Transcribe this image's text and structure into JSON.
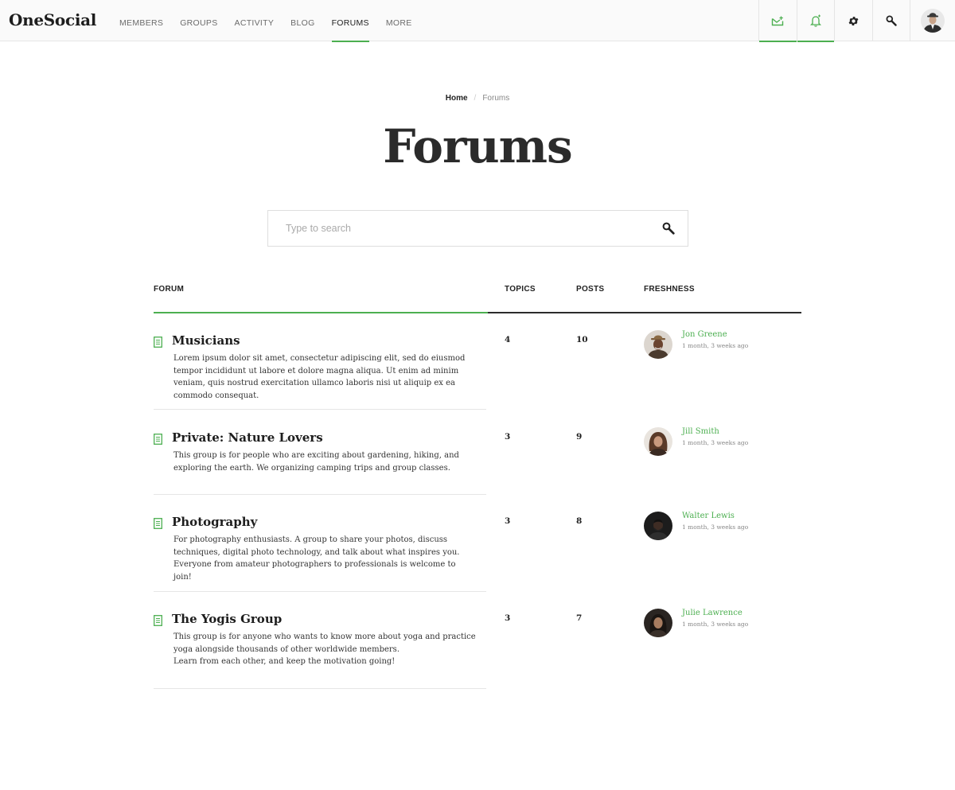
{
  "header": {
    "logo": "OneSocial",
    "nav": [
      {
        "label": "MEMBERS",
        "active": false
      },
      {
        "label": "GROUPS",
        "active": false
      },
      {
        "label": "ACTIVITY",
        "active": false
      },
      {
        "label": "BLOG",
        "active": false
      },
      {
        "label": "FORUMS",
        "active": true
      },
      {
        "label": "MORE",
        "active": false
      }
    ],
    "tools": [
      {
        "icon": "inbox-icon",
        "highlight": true
      },
      {
        "icon": "bell-icon",
        "highlight": true
      },
      {
        "icon": "gear-icon",
        "highlight": false
      },
      {
        "icon": "search-icon",
        "highlight": false
      },
      {
        "icon": "avatar",
        "highlight": false
      }
    ]
  },
  "breadcrumb": {
    "home": "Home",
    "current": "Forums"
  },
  "page_title": "Forums",
  "search": {
    "placeholder": "Type to search",
    "value": ""
  },
  "table": {
    "headers": {
      "forum": "FORUM",
      "topics": "TOPICS",
      "posts": "POSTS",
      "freshness": "FRESHNESS"
    },
    "rows": [
      {
        "title": "Musicians",
        "description": [
          "Lorem ipsum dolor sit amet, consectetur adipiscing elit, sed do eiusmod tempor incididunt ut labore et dolore magna aliqua. Ut enim ad minim veniam, quis nostrud exercitation ullamco laboris nisi ut aliquip ex ea commodo consequat."
        ],
        "topics": "4",
        "posts": "10",
        "author": "Jon Greene",
        "time": "1 month, 3 weeks ago"
      },
      {
        "title": "Private: Nature Lovers",
        "description": [
          "This group is for people who are exciting about gardening, hiking, and exploring the earth. We organizing camping trips and group classes."
        ],
        "topics": "3",
        "posts": "9",
        "author": "Jill Smith",
        "time": "1 month, 3 weeks ago"
      },
      {
        "title": "Photography",
        "description": [
          "For photography enthusiasts. A group to share your photos, discuss techniques, digital photo technology, and talk about what inspires you. Everyone from amateur photographers to professionals is welcome to join!"
        ],
        "topics": "3",
        "posts": "8",
        "author": "Walter Lewis",
        "time": "1 month, 3 weeks ago"
      },
      {
        "title": "The Yogis Group",
        "description": [
          "This group is for anyone who wants to know more about yoga and practice yoga alongside thousands of other worldwide members.",
          "Learn from each other, and keep the motivation going!"
        ],
        "topics": "3",
        "posts": "7",
        "author": "Julie Lawrence",
        "time": "1 month, 3 weeks ago"
      }
    ]
  },
  "colors": {
    "accent": "#4caf50",
    "text": "#222222",
    "muted": "#888888"
  }
}
